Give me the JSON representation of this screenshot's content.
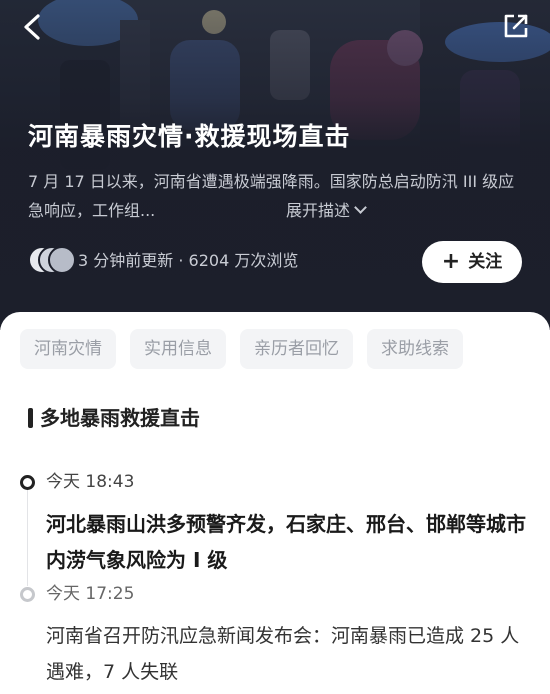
{
  "header": {
    "title": "河南暴雨灾情·救援现场直击",
    "description": "7 月 17 日以来，河南省遭遇极端强降雨。国家防总启动防汛 III 级应急响应，工作组...",
    "expand_label": "展开描述",
    "meta": "3 分钟前更新 · 6204 万次浏览",
    "follow_label": "关注"
  },
  "tabs": [
    "河南灾情",
    "实用信息",
    "亲历者回忆",
    "求助线索"
  ],
  "section": {
    "title": "多地暴雨救援直击"
  },
  "timeline": [
    {
      "time": "今天 18:43",
      "text": "河北暴雨山洪多预警齐发，石家庄、邢台、邯郸等城市内涝气象风险为 I 级"
    },
    {
      "time": "今天 17:25",
      "text": "河南省召开防汛应急新闻发布会：河南暴雨已造成 25 人遇难，7 人失联"
    }
  ],
  "icons": {
    "back": "chevron-left-icon",
    "share": "external-link-icon",
    "expand": "chevron-down-icon",
    "follow": "plus-icon"
  },
  "colors": {
    "hero_bg": "#1c1f2b",
    "tab_bg": "#f3f4f6",
    "tab_text": "#9a9ea6",
    "timeline_active": "#222222",
    "timeline_inactive": "#c6c8cc"
  }
}
